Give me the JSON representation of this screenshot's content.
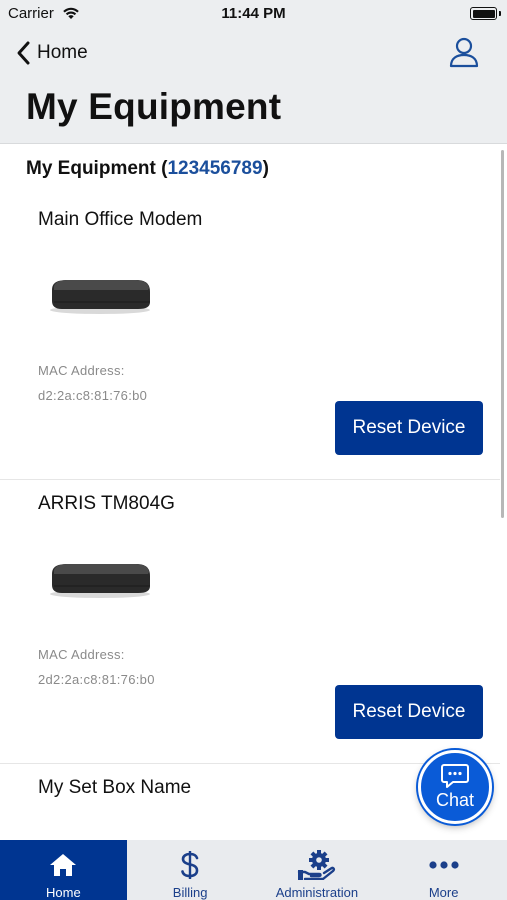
{
  "status_bar": {
    "carrier": "Carrier",
    "time": "11:44 PM"
  },
  "header": {
    "back_label": "Home",
    "title": "My Equipment"
  },
  "section": {
    "heading": "My Equipment",
    "open_paren": "(",
    "account_number": "123456789",
    "close_paren": ")"
  },
  "devices": [
    {
      "name": "Main Office Modem",
      "mac_label": "MAC Address:",
      "mac_value": "d2:2a:c8:81:76:b0",
      "button_label": "Reset Device"
    },
    {
      "name": "ARRIS TM804G",
      "mac_label": "MAC Address:",
      "mac_value": "2d2:2a:c8:81:76:b0",
      "button_label": "Reset Device"
    },
    {
      "name": "My Set Box Name"
    }
  ],
  "chat": {
    "label": "Chat"
  },
  "tabs": [
    {
      "label": "Home",
      "icon": "home-icon",
      "active": true
    },
    {
      "label": "Billing",
      "icon": "dollar-icon",
      "active": false
    },
    {
      "label": "Administration",
      "icon": "admin-gear-hand-icon",
      "active": false
    },
    {
      "label": "More",
      "icon": "more-dots-icon",
      "active": false
    }
  ],
  "colors": {
    "brand_blue": "#003591",
    "account_link": "#1b4f9c",
    "chat_blue": "#0a5bd7",
    "header_bg": "#eceef0"
  }
}
